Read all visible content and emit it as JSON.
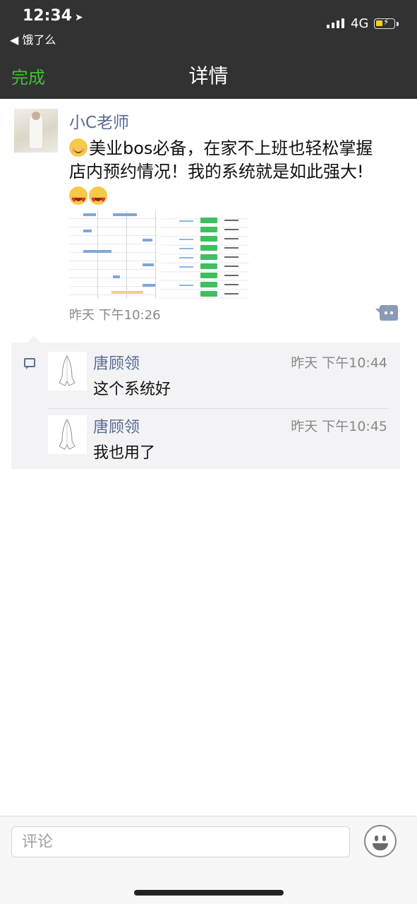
{
  "status_bar": {
    "time": "12:34",
    "back_app": "◀ 饿了么",
    "network": "4G"
  },
  "nav": {
    "done_label": "完成",
    "title": "详情"
  },
  "post": {
    "author": "小C老师",
    "text_line1": "美业bos必备，在家不上班也轻松掌握",
    "text_line2": "店内预约情况！我的系统就是如此强大!",
    "time": "昨天 下午10:26"
  },
  "comments": [
    {
      "name": "唐顾领",
      "time": "昨天 下午10:44",
      "text": "这个系统好"
    },
    {
      "name": "唐顾领",
      "time": "昨天 下午10:45",
      "text": "我也用了"
    }
  ],
  "comment_box": {
    "placeholder": "评论"
  },
  "colors": {
    "accent_green": "#40c234",
    "link_blue": "#576b95",
    "header_bg": "#323232"
  }
}
